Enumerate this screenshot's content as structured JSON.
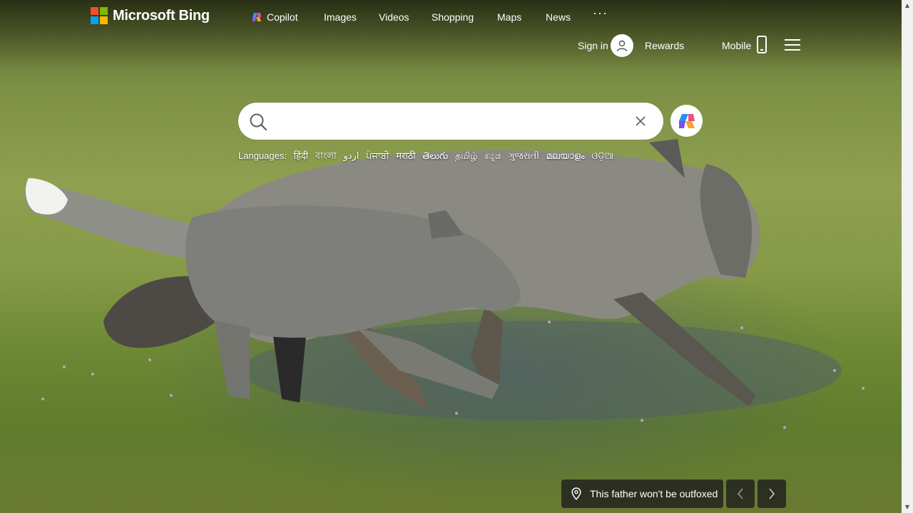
{
  "brand": {
    "name": "Microsoft Bing",
    "logo_colors": [
      "#f25022",
      "#7fba00",
      "#00a4ef",
      "#ffb900"
    ]
  },
  "nav": {
    "items": [
      {
        "label": "Copilot",
        "icon": "copilot-icon"
      },
      {
        "label": "Images"
      },
      {
        "label": "Videos"
      },
      {
        "label": "Shopping"
      },
      {
        "label": "Maps"
      },
      {
        "label": "News"
      }
    ],
    "more_label": "···"
  },
  "account": {
    "signin_label": "Sign in",
    "rewards_label": "Rewards",
    "mobile_label": "Mobile"
  },
  "search": {
    "placeholder": "",
    "value": ""
  },
  "languages": {
    "label": "Languages:",
    "items": [
      "हिंदी",
      "বাংলা",
      "اردو",
      "ਪੰਜਾਬੀ",
      "मराठी",
      "తెలుగు",
      "தமிழ்",
      "ಕನ್ನಡ",
      "ગુજરાતી",
      "മലയാളം",
      "ଓଡ଼ିଆ"
    ]
  },
  "image_of_day": {
    "caption": "This father won't be outfoxed"
  },
  "colors": {
    "accent": "#ffffff",
    "caption_bg": "#1e1e1e"
  }
}
